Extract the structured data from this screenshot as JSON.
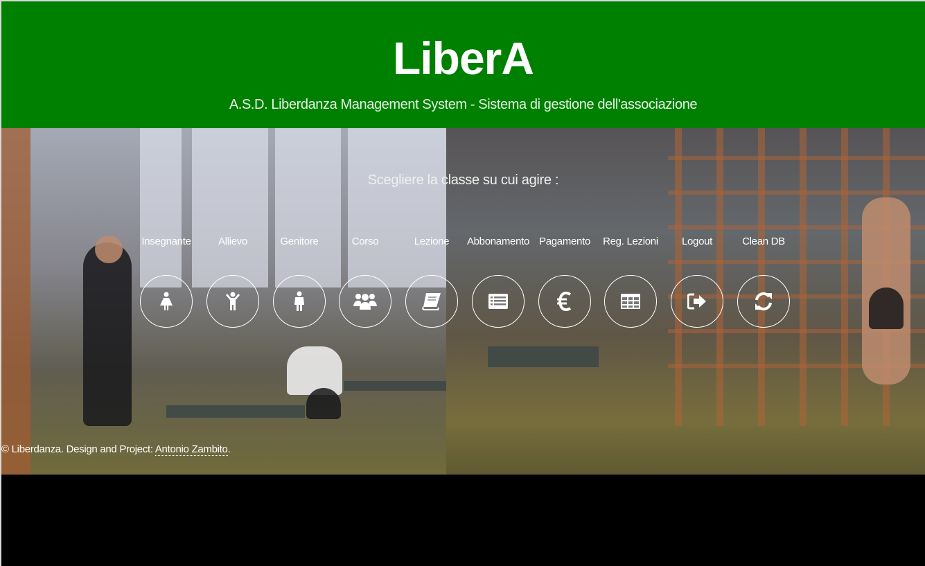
{
  "header": {
    "title": "LiberA",
    "subtitle": "A.S.D. Liberdanza Management System - Sistema di gestione dell'associazione",
    "background_color": "#008000"
  },
  "main": {
    "prompt": "Scegliere la classe su cui agire :",
    "nav_items": [
      {
        "label": "Insegnante",
        "icon": "female-icon"
      },
      {
        "label": "Allievo",
        "icon": "child-icon"
      },
      {
        "label": "Genitore",
        "icon": "male-icon"
      },
      {
        "label": "Corso",
        "icon": "users-icon"
      },
      {
        "label": "Lezione",
        "icon": "book-icon"
      },
      {
        "label": "Abbonamento",
        "icon": "list-alt-icon"
      },
      {
        "label": "Pagamento",
        "icon": "euro-icon"
      },
      {
        "label": "Reg. Lezioni",
        "icon": "table-icon"
      },
      {
        "label": "Logout",
        "icon": "sign-out-icon"
      },
      {
        "label": "Clean DB",
        "icon": "refresh-icon"
      }
    ]
  },
  "footer": {
    "copyright": "© Liberdanza. Design and Project: ",
    "author_link": "Antonio Zambito",
    "trailing": "."
  }
}
